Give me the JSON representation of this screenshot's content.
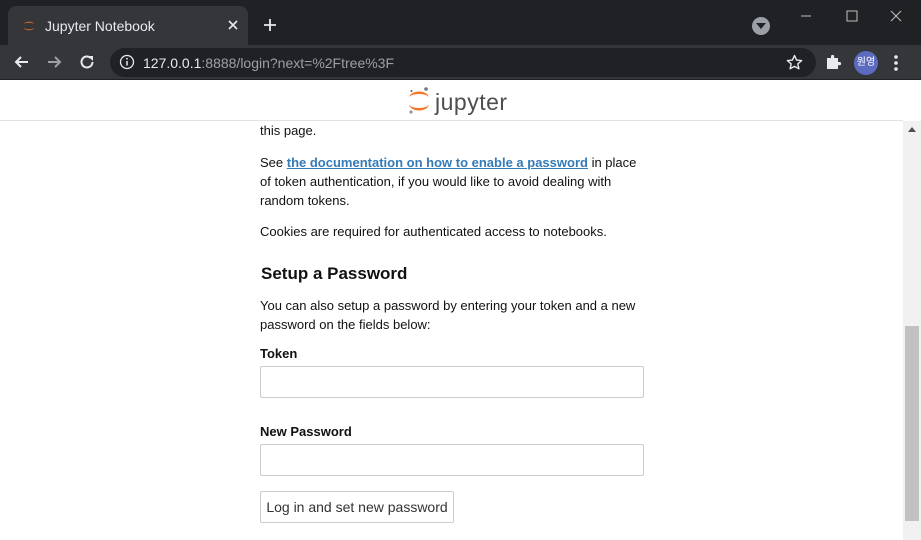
{
  "browser": {
    "tab_title": "Jupyter Notebook",
    "url_host": "127.0.0.1",
    "url_rest": ":8888/login?next=%2Ftree%3F",
    "profile_initials": "원영",
    "accent_color": "#f37726",
    "icons": [
      "jupyter-favicon",
      "close-icon",
      "plus-icon",
      "tab-search-icon",
      "back-arrow-icon",
      "forward-arrow-icon",
      "reload-icon",
      "info-icon",
      "star-icon",
      "extension-puzzle-icon",
      "more-vert-icon"
    ]
  },
  "page": {
    "logo_text": "jupyter",
    "intro_tail": "this page.",
    "doc_prefix": "See ",
    "doc_link": "the documentation on how to enable a password",
    "doc_line1_suffix": " in place",
    "doc_line2": "of token authentication, if you would like to avoid dealing with",
    "doc_line3": "random tokens.",
    "cookies_text": "Cookies are required for authenticated access to notebooks.",
    "setup_title": "Setup a Password",
    "setup_desc_line1": "You can also setup a password by entering your token and a new",
    "setup_desc_line2": "password on the fields below:",
    "token_label": "Token",
    "token_value": "",
    "new_password_label": "New Password",
    "new_password_value": "",
    "submit_label": "Log in and set new password"
  }
}
